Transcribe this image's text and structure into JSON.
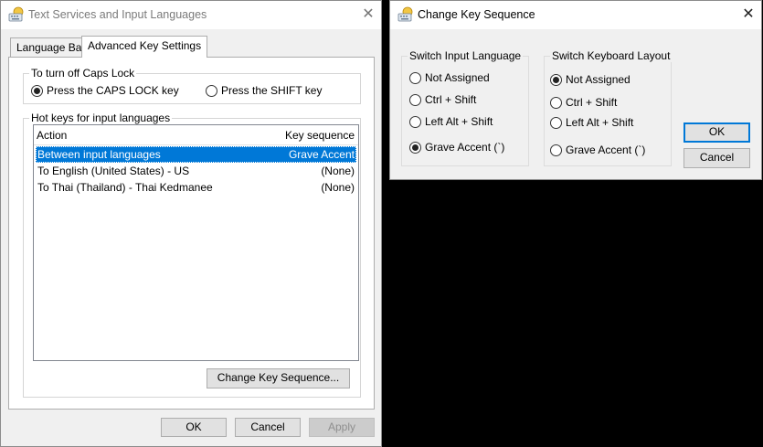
{
  "left_dialog": {
    "title": "Text Services and Input Languages",
    "close_glyph": "✕",
    "tabs": [
      {
        "label": "Language Bar"
      },
      {
        "label": "Advanced Key Settings"
      }
    ],
    "caps_lock": {
      "group_label": "To turn off Caps Lock",
      "options": [
        {
          "label": "Press the CAPS LOCK key",
          "selected": true
        },
        {
          "label": "Press the SHIFT key",
          "selected": false
        }
      ]
    },
    "hotkeys": {
      "group_label": "Hot keys for input languages",
      "columns": {
        "action": "Action",
        "key": "Key sequence"
      },
      "rows": [
        {
          "action": "Between input languages",
          "key": "Grave Accent",
          "selected": true
        },
        {
          "action": "To English (United States) - US",
          "key": "(None)",
          "selected": false
        },
        {
          "action": "To Thai (Thailand) - Thai Kedmanee",
          "key": "(None)",
          "selected": false
        }
      ],
      "change_button": "Change Key Sequence..."
    },
    "buttons": {
      "ok": "OK",
      "cancel": "Cancel",
      "apply": "Apply"
    }
  },
  "right_dialog": {
    "title": "Change Key Sequence",
    "close_glyph": "✕",
    "input_language": {
      "group_label": "Switch Input Language",
      "options": [
        {
          "label": "Not Assigned",
          "selected": false
        },
        {
          "label": "Ctrl + Shift",
          "selected": false
        },
        {
          "label": "Left Alt + Shift",
          "selected": false
        },
        {
          "label": "Grave Accent (`)",
          "selected": true
        }
      ]
    },
    "keyboard_layout": {
      "group_label": "Switch Keyboard Layout",
      "options": [
        {
          "label": "Not Assigned",
          "selected": true
        },
        {
          "label": "Ctrl + Shift",
          "selected": false
        },
        {
          "label": "Left Alt + Shift",
          "selected": false
        },
        {
          "label": "Grave Accent (`)",
          "selected": false
        }
      ]
    },
    "buttons": {
      "ok": "OK",
      "cancel": "Cancel"
    }
  },
  "colors": {
    "selection": "#0078d7",
    "dialog_bg": "#f0f0f0",
    "desktop_bg": "#000000"
  },
  "icons": [
    "keyboard-globe-icon",
    "close-icon",
    "radio-icon"
  ]
}
